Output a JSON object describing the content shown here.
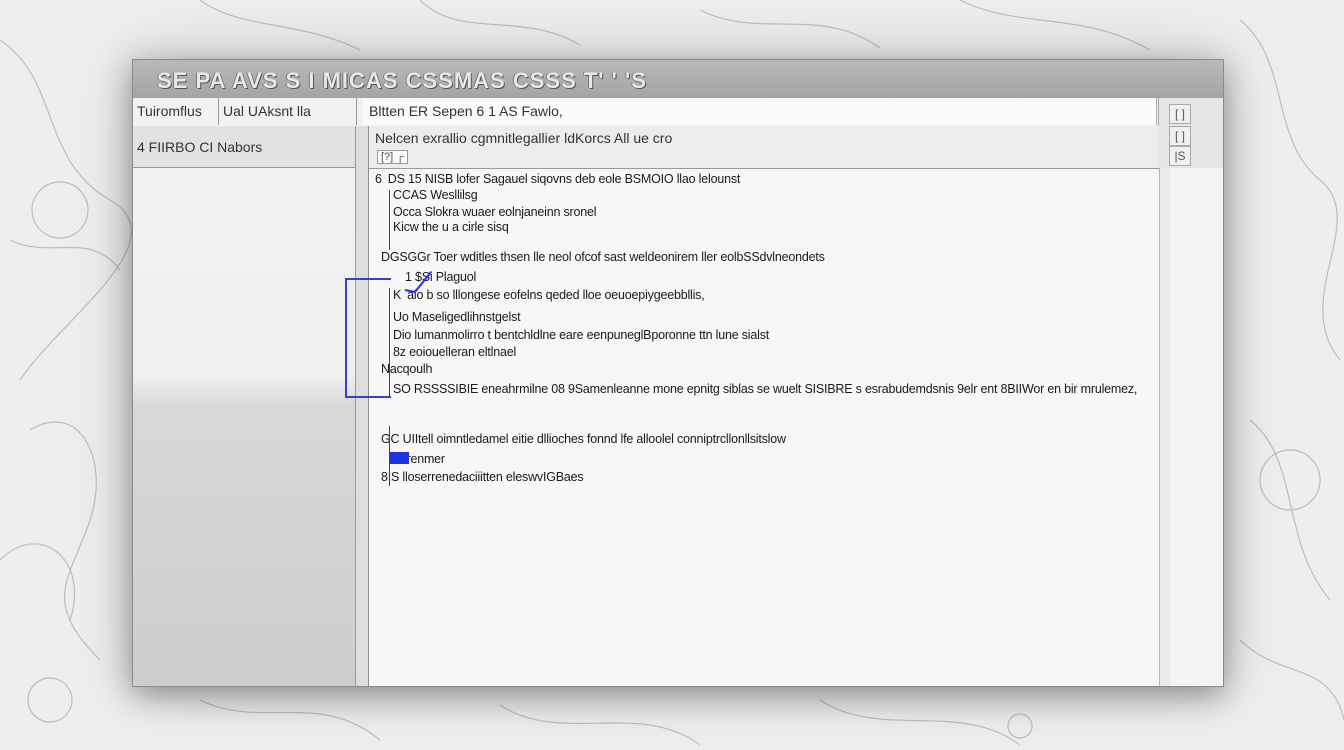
{
  "window": {
    "title": "SE PA AVS S I MICAS CSSMAS CSSS T' ' 'S"
  },
  "tabs": [
    {
      "label": "Tuiromflus"
    },
    {
      "label": "Ual UAksnt lla"
    }
  ],
  "path": "Bltten ER Sepen 6 1 AS Fawlo,",
  "left_panel": {
    "header": "4 FIIRBO CI Nabors"
  },
  "description": {
    "text": "Nelcen exrallio cgmnitlegallier ldKorcs All ue cro",
    "icons": "[?] ┌"
  },
  "corner_buttons": [
    "[ ]",
    "[ ]",
    "|S"
  ],
  "content_lines": [
    {
      "indent": 0,
      "prefix": "6",
      "text": "DS 15 NISB lofer Sagauel siqovns deb eole BSMOIO llao lelounst"
    },
    {
      "indent": 1,
      "prefix": "",
      "text": "CCAS Wesllilsg"
    },
    {
      "indent": 1,
      "prefix": "",
      "text": "Occa Slokra wuaer eolnjaneinn sronel"
    },
    {
      "indent": 1,
      "prefix": "",
      "text": "Kicw the u a cirle sisq"
    },
    {
      "indent": 0,
      "prefix": "",
      "text": "DGSGGr Toer wditles thsen lle neol ofcof sast weldeonirem  ller eolbSSdvlneondets"
    },
    {
      "indent": 2,
      "prefix": "",
      "text": "1 $Si Plaguol"
    },
    {
      "indent": 1,
      "prefix": "K",
      "text": "aio b so lllongese eofelns qeded lloe oeuoepiygeebbllis,"
    },
    {
      "indent": 1,
      "prefix": "",
      "text": "Uo Maseligedlihnstgelst"
    },
    {
      "indent": 1,
      "prefix": "",
      "text": "Dio lumanmolirro t bentchldlne eare eenpuneglBporonne ttn lune sialst"
    },
    {
      "indent": 1,
      "prefix": "",
      "text": "8z eoiouelleran eltlnael"
    },
    {
      "indent": 0,
      "prefix": "",
      "text": "Nacqoulh"
    },
    {
      "indent": 1,
      "prefix": "",
      "text": "SO RSSSSIBIE eneahrmilne 08 9Samenleanne mone epnitg  siblas se wuelt SISIBRE s esrabudemdsnis 9elr ent 8BIIWor en bir mrulemez,"
    },
    {
      "indent": 0,
      "prefix": "",
      "text": "GC UIItell oimntledamel eitie dllioches fonnd lfe alloolel conniptrcllonllsitslow"
    },
    {
      "indent": 1,
      "prefix": "",
      "text": "uerenmer"
    },
    {
      "indent": 0,
      "prefix": "",
      "text": "8IS lloserrenedaciiitten eleswvIGBaes"
    }
  ],
  "colors": {
    "selection_outline": "#3344cc",
    "selection_mark": "#2233dd",
    "titlebar": "#a9a9a9"
  }
}
